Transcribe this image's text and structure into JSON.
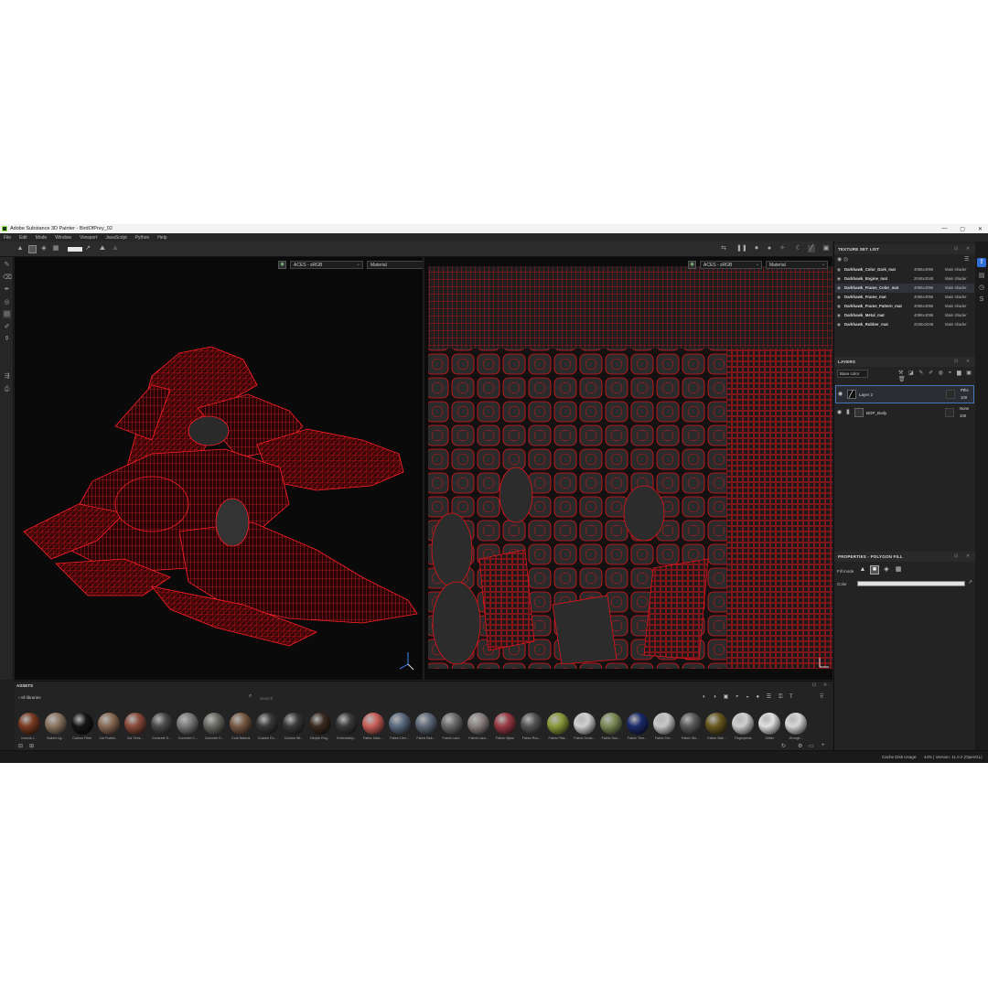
{
  "window": {
    "title": "Adobe Substance 3D Painter - BirdOfPrey_02",
    "controls": [
      "—",
      "▢",
      "✕"
    ]
  },
  "menu": [
    "File",
    "Edit",
    "Mode",
    "Window",
    "Viewport",
    "JavaScript",
    "Python",
    "Help"
  ],
  "viewports": {
    "left": {
      "colorspace": "ACES - sRGB",
      "channel": "Material"
    },
    "right": {
      "colorspace": "ACES - sRGB",
      "channel": "Material"
    },
    "wireframe_color": "#e0141b"
  },
  "texture_set_list": {
    "title": "TEXTURE SET LIST",
    "rows": [
      {
        "name": "Darkhawk_Color_Dark_mat",
        "res": "4096x4096",
        "shader": "Main shader"
      },
      {
        "name": "Darkhawk_Engine_mat",
        "res": "2048x2048",
        "shader": "Main shader"
      },
      {
        "name": "Darkhawk_Frame_Color_mat",
        "res": "4096x4096",
        "shader": "Main shader"
      },
      {
        "name": "Darkhawk_Frame_mat",
        "res": "4096x4096",
        "shader": "Main shader"
      },
      {
        "name": "Darkhawk_Frame_Pattern_mat",
        "res": "4096x4096",
        "shader": "Main shader"
      },
      {
        "name": "Darkhawk_Metal_mat",
        "res": "4096x4096",
        "shader": "Main shader"
      },
      {
        "name": "Darkhawk_Rubber_mat",
        "res": "2048x2048",
        "shader": "Main shader"
      }
    ]
  },
  "layers": {
    "title": "LAYERS",
    "channel": "Base color",
    "items": [
      {
        "name": "Layer 2",
        "blend": "Pths",
        "opacity": "100"
      },
      {
        "name": "BOP_Body",
        "blend": "None",
        "opacity": "100"
      }
    ]
  },
  "properties": {
    "title": "PROPERTIES - POLYGON FILL",
    "fill_mode_label": "Fill mode",
    "color_label": "Color"
  },
  "assets": {
    "title": "ASSETS",
    "library": "All libraries",
    "search_placeholder": "Search",
    "items": [
      {
        "label": "Insects L...",
        "color": "#7a3a22"
      },
      {
        "label": "Baked Lig...",
        "color": "#8a7560"
      },
      {
        "label": "Carbon Fibre",
        "color": "#151515"
      },
      {
        "label": "Car Rubbe...",
        "color": "#8a6a55"
      },
      {
        "label": "Car Tires...",
        "color": "#8a4a3a"
      },
      {
        "label": "Concrete S...",
        "color": "#4a4a4a"
      },
      {
        "label": "Concrete C...",
        "color": "#7a7a7a"
      },
      {
        "label": "Concrete D...",
        "color": "#6a6a62"
      },
      {
        "label": "Cork Natural",
        "color": "#7a5a45"
      },
      {
        "label": "Custom Ex...",
        "color": "#3a3a3a"
      },
      {
        "label": "Custom Wi...",
        "color": "#3a3a3a"
      },
      {
        "label": "Dimple Rug...",
        "color": "#3a2a20"
      },
      {
        "label": "Embroidery...",
        "color": "#3a3a3a"
      },
      {
        "label": "Fabric Dark...",
        "color": "#c8605a"
      },
      {
        "label": "Fabric Den...",
        "color": "#5a6a80"
      },
      {
        "label": "Fabric Bab...",
        "color": "#606a7a"
      },
      {
        "label": "Fabric Lace...",
        "color": "#6a6a6a"
      },
      {
        "label": "Fabric Lanc...",
        "color": "#8a8080"
      },
      {
        "label": "Fabric Nylon",
        "color": "#9a3a45"
      },
      {
        "label": "Fabric Rou...",
        "color": "#555555"
      },
      {
        "label": "Fabric Plas...",
        "color": "#8a9a3a"
      },
      {
        "label": "Fabric Scotc...",
        "color": "#d0d0d0"
      },
      {
        "label": "Fabric Sou...",
        "color": "#7a8a55"
      },
      {
        "label": "Fabric Thre...",
        "color": "#1a2a6a"
      },
      {
        "label": "Fabric Tee...",
        "color": "#c8c8c8"
      },
      {
        "label": "Fabric Wo...",
        "color": "#5a5a5a"
      },
      {
        "label": "Fabric Wat...",
        "color": "#6a5a20"
      },
      {
        "label": "Fingerprints",
        "color": "#cfcfcf"
      },
      {
        "label": "Glitter",
        "color": "#e0e0e0"
      },
      {
        "label": "Grunge...",
        "color": "#d8d8d8"
      }
    ]
  },
  "status": {
    "left": "Cache Disk Usage:",
    "right": "44% | Version: 11.0.2 (OpenGL)"
  }
}
